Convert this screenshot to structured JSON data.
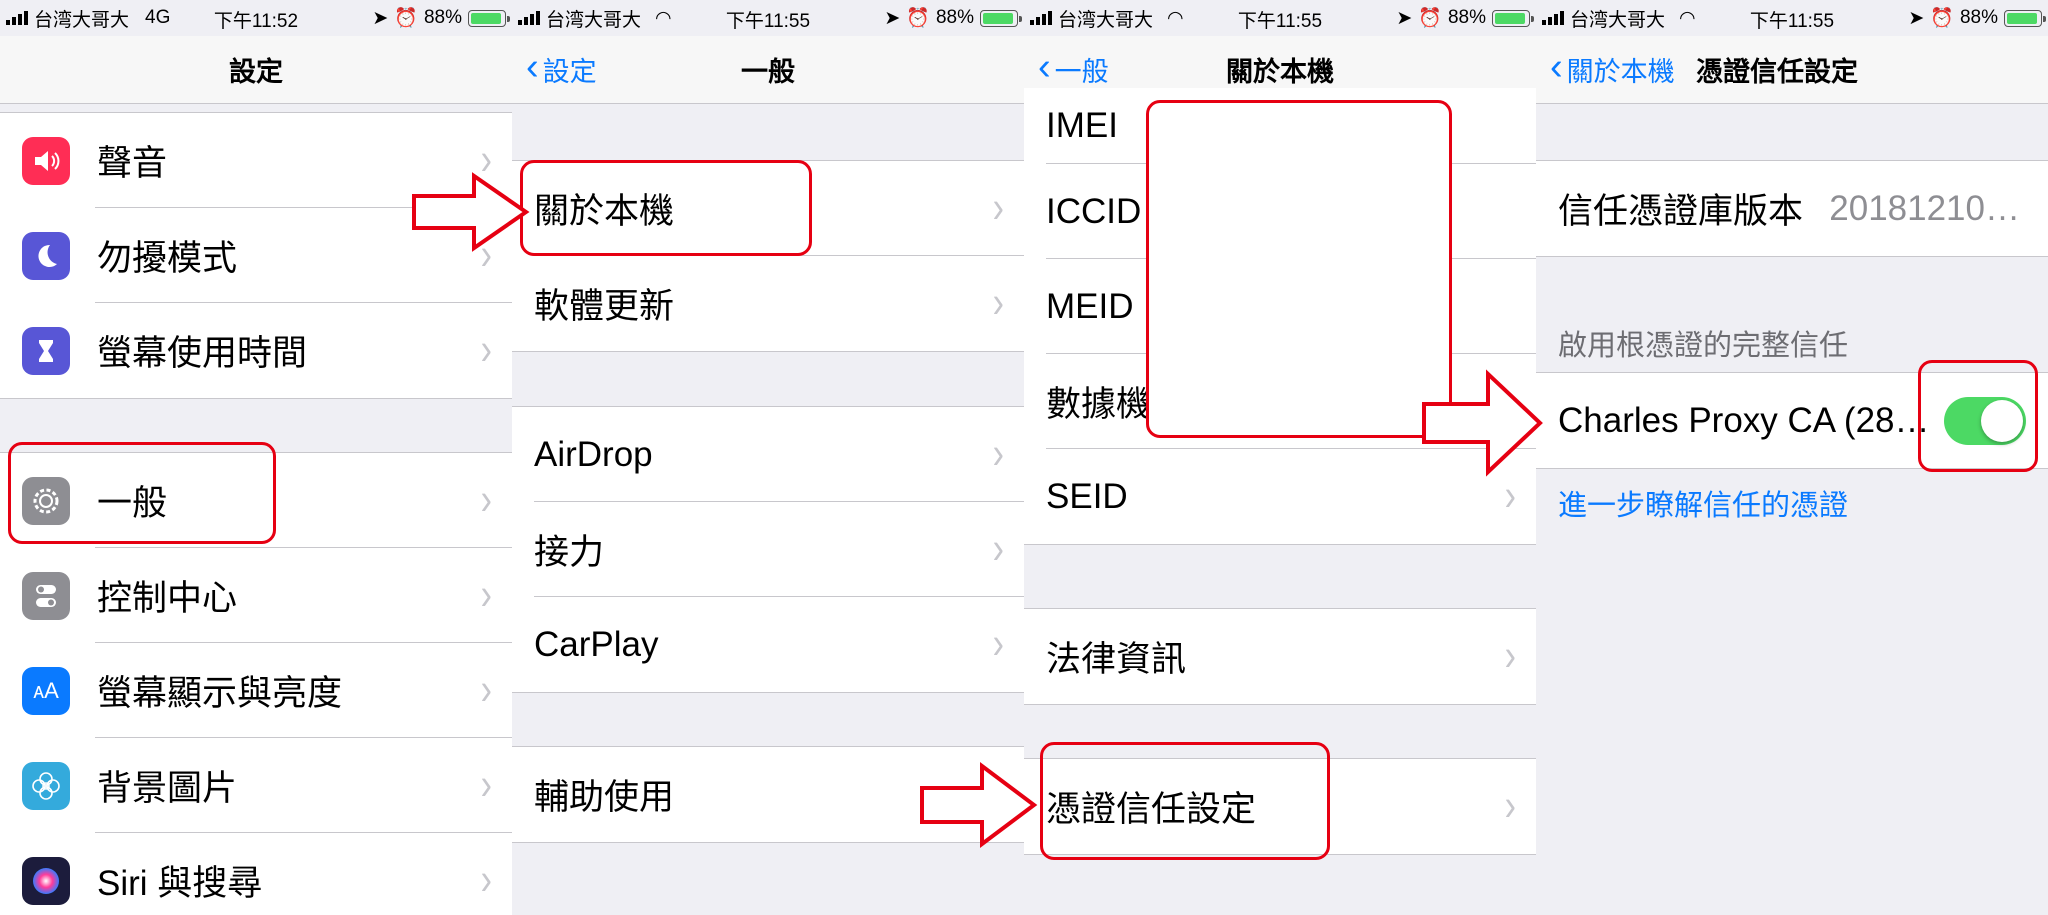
{
  "statusbars": [
    {
      "carrier": "台湾大哥大",
      "network": "4G",
      "time": "下午11:52",
      "battery": "88%",
      "battery_level": 0.88
    },
    {
      "carrier": "台湾大哥大",
      "network": "",
      "time": "下午11:55",
      "battery": "88%",
      "battery_level": 0.88
    },
    {
      "carrier": "台湾大哥大",
      "network": "",
      "time": "下午11:55",
      "battery": "88%",
      "battery_level": 0.88
    },
    {
      "carrier": "台湾大哥大",
      "network": "",
      "time": "下午11:55",
      "battery": "88%",
      "battery_level": 0.88
    }
  ],
  "panel1": {
    "title": "設定",
    "items": [
      {
        "label": "聲音",
        "icon": "speaker-icon",
        "color": "#ff2d55"
      },
      {
        "label": "勿擾模式",
        "icon": "moon-icon",
        "color": "#5856d6"
      },
      {
        "label": "螢幕使用時間",
        "icon": "hourglass-icon",
        "color": "#5856d6"
      },
      {
        "label": "一般",
        "icon": "gear-icon",
        "color": "#8e8e93"
      },
      {
        "label": "控制中心",
        "icon": "toggles-icon",
        "color": "#8e8e93"
      },
      {
        "label": "螢幕顯示與亮度",
        "icon": "text-size-icon",
        "color": "#0a7aff"
      },
      {
        "label": "背景圖片",
        "icon": "flower-icon",
        "color": "#34aadc"
      },
      {
        "label": "Siri 與搜尋",
        "icon": "siri-icon",
        "color": "#1c1c3c"
      }
    ]
  },
  "panel2": {
    "back": "設定",
    "title": "一般",
    "group1": [
      "關於本機",
      "軟體更新"
    ],
    "group2": [
      "AirDrop",
      "接力",
      "CarPlay"
    ],
    "group3": [
      "輔助使用"
    ]
  },
  "panel3": {
    "back": "一般",
    "title": "關於本機",
    "group1": [
      "IMEI",
      "ICCID",
      "MEID",
      "數據機",
      "SEID"
    ],
    "group2": [
      "法律資訊"
    ],
    "group3": [
      "憑證信任設定"
    ]
  },
  "panel4": {
    "back": "關於本機",
    "title": "憑證信任設定",
    "trust_store_label": "信任憑證庫版本",
    "trust_store_value": "20181210…",
    "section_header": "啟用根憑證的完整信任",
    "cert_label": "Charles Proxy CA (28…",
    "cert_enabled": true,
    "learn_more": "進一步瞭解信任的憑證"
  },
  "colors": {
    "annotation_red": "#e60012",
    "ios_blue": "#0a7aff",
    "switch_green": "#4cd964"
  }
}
